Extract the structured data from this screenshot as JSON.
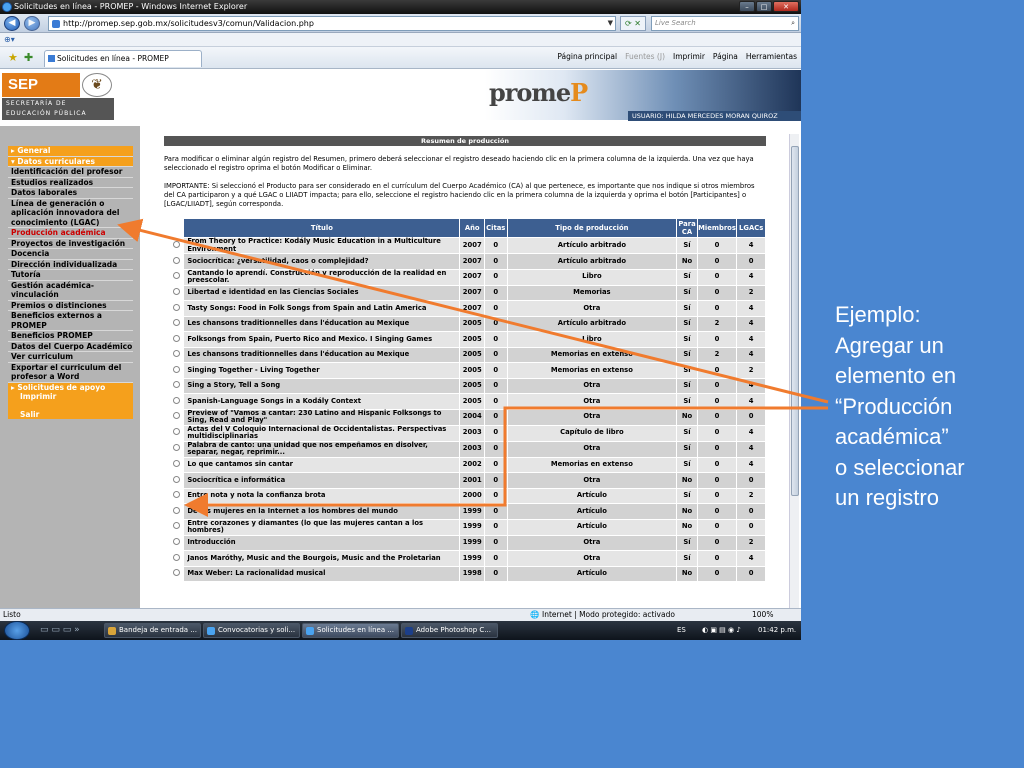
{
  "browser": {
    "title": "Solicitudes en línea - PROMEP - Windows Internet Explorer",
    "url": "http://promep.sep.gob.mx/solicitudesv3/comun/Validacion.php",
    "search_placeholder": "Live Search",
    "tab_label": "Solicitudes en línea - PROMEP",
    "tools": [
      "Página principal",
      "Fuentes (J)",
      "Imprimir",
      "Página",
      "Herramientas"
    ],
    "status_left": "Listo",
    "status_zone": "Internet | Modo protegido: activado",
    "zoom": "100%"
  },
  "header": {
    "sep": "SEP",
    "sep_sub_1": "SECRETARÍA DE",
    "sep_sub_2": "EDUCACIÓN PÚBLICA",
    "brand_a": "prome",
    "brand_b": "P",
    "user": "USUARIO: HILDA MERCEDES MORAN QUIROZ"
  },
  "menu": {
    "general": "General",
    "datos": "Datos curriculares",
    "items": [
      "Identificación del profesor",
      "Estudios realizados",
      "Datos laborales",
      "Línea de generación o aplicación innovadora del conocimiento (LGAC)",
      "Producción académica",
      "Proyectos de investigación",
      "Docencia",
      "Dirección individualizada",
      "Tutoría",
      "Gestión académica-vinculación",
      "Premios o distinciones",
      "Beneficios externos a PROMEP",
      "Beneficios PROMEP",
      "Datos del Cuerpo Académico",
      "Ver curriculum",
      "Exportar el curriculum del profesor a Word"
    ],
    "apoyo": "Solicitudes de apoyo",
    "imprimir": "Imprimir",
    "salir": "Salir"
  },
  "main": {
    "title": "Resumen de producción",
    "intro": "Para modificar o eliminar algún registro del Resumen, primero deberá seleccionar el registro deseado haciendo clic en la primera columna de la izquierda. Una vez que haya seleccionado el registro oprima el botón Modificar o Eliminar.",
    "important": "IMPORTANTE: Si seleccionó el Producto para ser considerado en el currículum del Cuerpo Académico (CA) al que pertenece, es importante que nos indique si otros miembros del CA participaron y a qué LGAC o LIIADT impacta; para ello, seleccione el registro haciendo clic en la primera columna de la izquierda y oprima el botón [Participantes] o [LGAC/LIIADT], según corresponda.",
    "columns": [
      "Título",
      "Año",
      "Citas",
      "Tipo de producción",
      "Para CA",
      "Miembros",
      "LGACs"
    ],
    "rows": [
      [
        "From Theory to Practice: Kodály Music Education in a Multiculture Environment",
        "2007",
        "0",
        "Artículo arbitrado",
        "Sí",
        "0",
        "4"
      ],
      [
        "Sociocrítica: ¿versatilidad, caos o complejidad?",
        "2007",
        "0",
        "Artículo arbitrado",
        "No",
        "0",
        "0"
      ],
      [
        "Cantando lo aprendí. Construcción y reproducción de la realidad en preescolar.",
        "2007",
        "0",
        "Libro",
        "Sí",
        "0",
        "4"
      ],
      [
        "Libertad e identidad en las Ciencias Sociales",
        "2007",
        "0",
        "Memorias",
        "Sí",
        "0",
        "2"
      ],
      [
        "Tasty Songs: Food in Folk Songs from Spain and Latin America",
        "2007",
        "0",
        "Otra",
        "Sí",
        "0",
        "4"
      ],
      [
        "Les chansons traditionnelles dans l'éducation au Mexique",
        "2005",
        "0",
        "Artículo arbitrado",
        "Sí",
        "2",
        "4"
      ],
      [
        "Folksongs from Spain, Puerto Rico and Mexico. I Singing Games",
        "2005",
        "0",
        "Libro",
        "Sí",
        "0",
        "4"
      ],
      [
        "Les chansons traditionnelles dans l'éducation au Mexique",
        "2005",
        "0",
        "Memorias en extenso",
        "Sí",
        "2",
        "4"
      ],
      [
        "Singing Together - Living Together",
        "2005",
        "0",
        "Memorias en extenso",
        "Sí",
        "0",
        "2"
      ],
      [
        "Sing a Story, Tell a Song",
        "2005",
        "0",
        "Otra",
        "Sí",
        "0",
        "4"
      ],
      [
        "Spanish-Language Songs in a Kodály Context",
        "2005",
        "0",
        "Otra",
        "Sí",
        "0",
        "4"
      ],
      [
        "Preview of \"Vamos a cantar: 230 Latino and Hispanic Folksongs to Sing, Read and Play\"",
        "2004",
        "0",
        "Otra",
        "No",
        "0",
        "0"
      ],
      [
        "Actas del V Coloquio Internacional de Occidentalistas. Perspectivas multidisciplinarias",
        "2003",
        "0",
        "Capítulo de libro",
        "Sí",
        "0",
        "4"
      ],
      [
        "Palabra de canto: una unidad que nos empeñamos en disolver, separar, negar, reprimir...",
        "2003",
        "0",
        "Otra",
        "Sí",
        "0",
        "4"
      ],
      [
        "Lo que cantamos sin cantar",
        "2002",
        "0",
        "Memorias en extenso",
        "Sí",
        "0",
        "4"
      ],
      [
        "Sociocrítica e informática",
        "2001",
        "0",
        "Otra",
        "No",
        "0",
        "0"
      ],
      [
        "Entre nota y nota la confianza brota",
        "2000",
        "0",
        "Artículo",
        "Sí",
        "0",
        "2"
      ],
      [
        "De las mujeres en la Internet a los hombres del mundo",
        "1999",
        "0",
        "Artículo",
        "No",
        "0",
        "0"
      ],
      [
        "Entre corazones y diamantes (lo que las mujeres cantan a los hombres)",
        "1999",
        "0",
        "Artículo",
        "No",
        "0",
        "0"
      ],
      [
        "Introducción",
        "1999",
        "0",
        "Otra",
        "Sí",
        "0",
        "2"
      ],
      [
        "Janos Maróthy, Music and the Bourgois, Music and the Proletarian",
        "1999",
        "0",
        "Otra",
        "Sí",
        "0",
        "4"
      ],
      [
        "Max Weber: La racionalidad musical",
        "1998",
        "0",
        "Artículo",
        "No",
        "0",
        "0"
      ]
    ]
  },
  "taskbar": {
    "buttons": [
      "Bandeja de entrada ...",
      "Convocatorias y soli...",
      "Solicitudes en línea ...",
      "Adobe Photoshop C..."
    ],
    "lang": "ES",
    "time": "01:42 p.m."
  },
  "annotation": {
    "lines": [
      "Ejemplo:",
      "Agregar  un",
      "elemento en",
      "“Producción",
      "académica”",
      "o seleccionar",
      "un registro"
    ],
    "arrow_color": "#f07b2e"
  }
}
